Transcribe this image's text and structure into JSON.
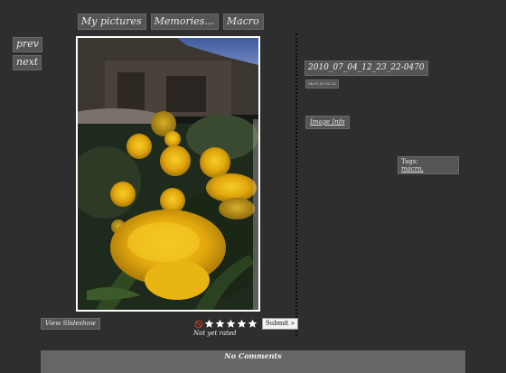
{
  "breadcrumb": {
    "items": [
      "My pictures",
      "Memories...",
      "Macro"
    ]
  },
  "nav": {
    "prev_label": "prev",
    "next_label": "next"
  },
  "photo": {
    "title": "2010_07_04_12_23_22-0470",
    "date": "04.07.10 02:23",
    "image_info_label": "Image Info"
  },
  "tags": {
    "label": "Tags:",
    "items": [
      "macro,"
    ]
  },
  "slideshow": {
    "label": "View Slideshow"
  },
  "rating": {
    "star_count": 5,
    "submit_label": "Submit »",
    "status": "Not yet rated"
  },
  "comments": {
    "label": "No Comments"
  },
  "colors": {
    "background": "#2e2e2e",
    "button_bg": "#555555",
    "photo_border": "#ffffff",
    "flower": "#e8b412"
  },
  "icons": {
    "no_rating": "no-rating-icon",
    "star": "star-icon"
  }
}
